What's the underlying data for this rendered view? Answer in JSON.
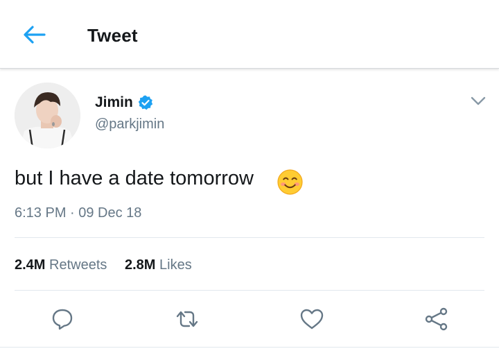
{
  "header": {
    "title": "Tweet",
    "back_icon": "arrow-left-icon",
    "accent_color": "#1da1f2"
  },
  "tweet": {
    "author": {
      "display_name": "Jimin",
      "handle": "@parkjimin",
      "verified": true
    },
    "text": "but I have a date tomorrow",
    "emoji": "smiling-face-emoji",
    "timestamp": "6:13 PM · 09 Dec 18",
    "stats": {
      "retweets_count": "2.4M",
      "retweets_label": "Retweets",
      "likes_count": "2.8M",
      "likes_label": "Likes"
    },
    "actions": [
      "reply-icon",
      "retweet-icon",
      "like-icon",
      "share-icon"
    ]
  },
  "colors": {
    "text_primary": "#14171a",
    "text_secondary": "#657786",
    "divider": "#e1e8ed",
    "verified_badge": "#1da1f2"
  }
}
